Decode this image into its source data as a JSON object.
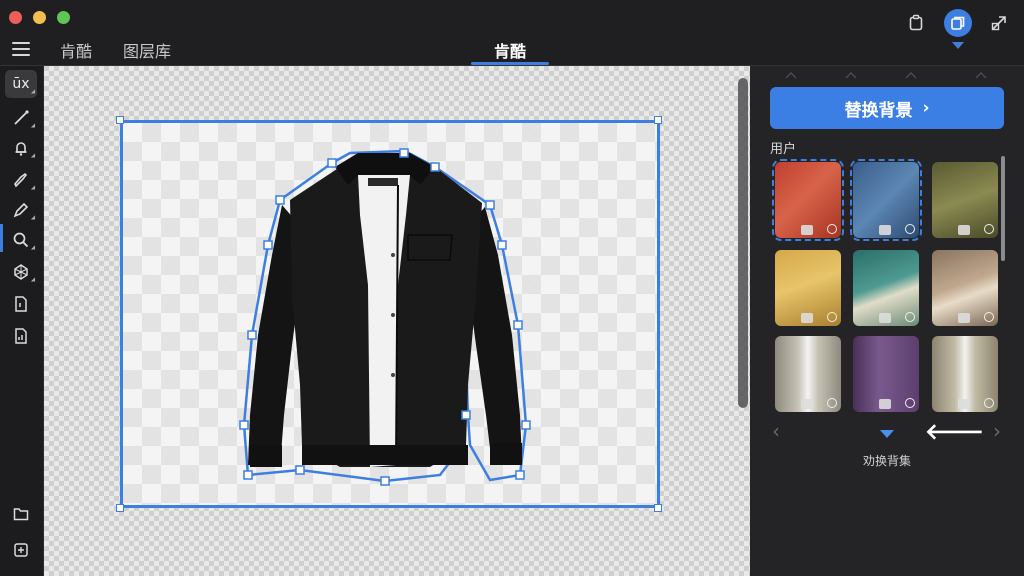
{
  "window": {
    "traffic_lights": [
      "close",
      "minimize",
      "maximize"
    ]
  },
  "header": {
    "tabs": [
      {
        "label": "肯酷"
      },
      {
        "label": "图层库"
      }
    ],
    "center_tab": "肯酷",
    "right_icons": [
      "clipboard-icon",
      "duplicate-icon",
      "export-icon"
    ],
    "accent": "#3d7fe0"
  },
  "left_toolbar": {
    "items": [
      {
        "name": "text-tool",
        "label": "ūx"
      },
      {
        "name": "line-tool"
      },
      {
        "name": "bell-tool"
      },
      {
        "name": "brush-tool"
      },
      {
        "name": "pen-tool"
      },
      {
        "name": "zoom-tool"
      },
      {
        "name": "transform-tool"
      },
      {
        "name": "page-tool"
      },
      {
        "name": "chart-tool"
      }
    ],
    "bottom_items": [
      {
        "name": "folder-tool"
      },
      {
        "name": "settings-tool"
      }
    ]
  },
  "canvas": {
    "subject": "black jacket with white t-shirt"
  },
  "right_panel": {
    "replace_button": "替换背景",
    "replace_chevron": "›",
    "section_title": "用户",
    "thumbnails": [
      {
        "name": "red-shirt",
        "selected": true
      },
      {
        "name": "blue-shirt",
        "selected": true
      },
      {
        "name": "olive-shirt",
        "selected": false
      },
      {
        "name": "yellow-texture",
        "selected": false
      },
      {
        "name": "teal-texture",
        "selected": false
      },
      {
        "name": "beige-texture",
        "selected": false
      },
      {
        "name": "grey-jacket",
        "selected": false
      },
      {
        "name": "purple-shirt",
        "selected": false
      },
      {
        "name": "khaki-jacket",
        "selected": false
      }
    ],
    "nav_prev": "‹",
    "nav_next": "›",
    "caption": "劝换背集"
  }
}
